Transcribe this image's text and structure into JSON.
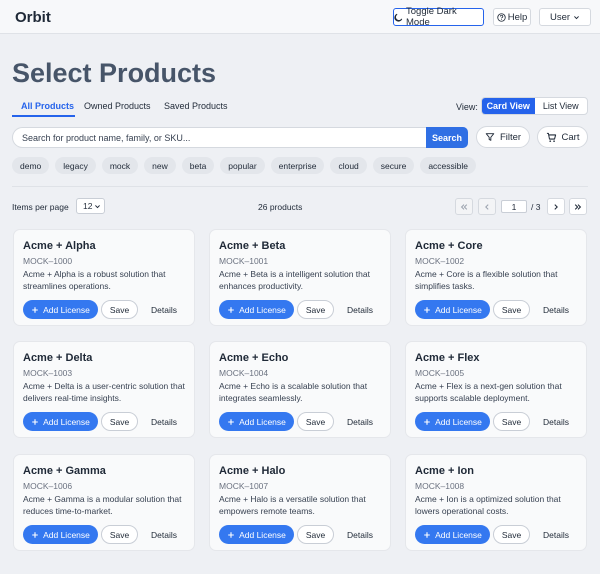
{
  "app": {
    "brand": "Orbit"
  },
  "topbar": {
    "dark_mode_label": "Toggle Dark Mode",
    "help_label": "Help",
    "user_label": "User"
  },
  "page": {
    "title": "Select Products"
  },
  "tabs": [
    {
      "label": "All Products",
      "active": true
    },
    {
      "label": "Owned Products",
      "active": false
    },
    {
      "label": "Saved Products",
      "active": false
    }
  ],
  "view": {
    "label": "View:",
    "options": [
      "Card View",
      "List View"
    ],
    "selected": "Card View"
  },
  "search": {
    "placeholder": "Search for product name, family, or SKU...",
    "value": "",
    "button_label": "Search"
  },
  "filter_label": "Filter",
  "cart_label": "Cart",
  "tags": [
    "demo",
    "legacy",
    "mock",
    "new",
    "beta",
    "popular",
    "enterprise",
    "cloud",
    "secure",
    "accessible"
  ],
  "pagination": {
    "items_per_page_label": "Items per page",
    "items_per_page": "12",
    "count_text": "26 products",
    "current_page": "1",
    "total_text": "/ 3"
  },
  "card_actions": {
    "add_label": "Add License",
    "save_label": "Save",
    "details_label": "Details"
  },
  "products": [
    {
      "name": "Acme + Alpha",
      "sku": "MOCK–1000",
      "desc": "Acme + Alpha is a robust solution that streamlines operations."
    },
    {
      "name": "Acme + Beta",
      "sku": "MOCK–1001",
      "desc": "Acme + Beta is a intelligent solution that enhances productivity."
    },
    {
      "name": "Acme + Core",
      "sku": "MOCK–1002",
      "desc": "Acme + Core is a flexible solution that simplifies tasks."
    },
    {
      "name": "Acme + Delta",
      "sku": "MOCK–1003",
      "desc": "Acme + Delta is a user-centric solution that delivers real-time insights."
    },
    {
      "name": "Acme + Echo",
      "sku": "MOCK–1004",
      "desc": "Acme + Echo is a scalable solution that integrates seamlessly."
    },
    {
      "name": "Acme + Flex",
      "sku": "MOCK–1005",
      "desc": "Acme + Flex is a next-gen solution that supports scalable deployment."
    },
    {
      "name": "Acme + Gamma",
      "sku": "MOCK–1006",
      "desc": "Acme + Gamma is a modular solution that reduces time-to-market."
    },
    {
      "name": "Acme + Halo",
      "sku": "MOCK–1007",
      "desc": "Acme + Halo is a versatile solution that empowers remote teams."
    },
    {
      "name": "Acme + Ion",
      "sku": "MOCK–1008",
      "desc": "Acme + Ion is a optimized solution that lowers operational costs."
    }
  ],
  "colors": {
    "accent": "#2563eb",
    "title": "#475569",
    "background": "#eef0f4"
  }
}
